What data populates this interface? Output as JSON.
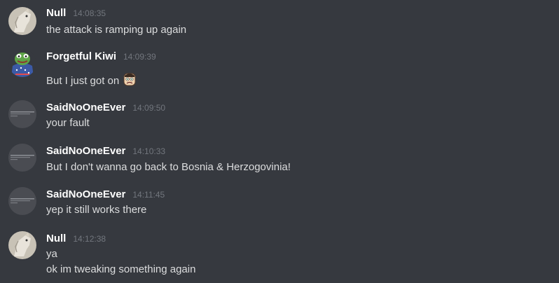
{
  "messages": [
    {
      "author": "Null",
      "timestamp": "14:08:35",
      "avatar": "horse-avatar",
      "lines": [
        "the attack is ramping up again"
      ]
    },
    {
      "author": "Forgetful Kiwi",
      "timestamp": "14:09:39",
      "avatar": "frog-flag-avatar",
      "lines": [
        "But I just got on"
      ],
      "emoji": "sad-face-emoji"
    },
    {
      "author": "SaidNoOneEver",
      "timestamp": "14:09:50",
      "avatar": "text-avatar",
      "lines": [
        "your fault"
      ]
    },
    {
      "author": "SaidNoOneEver",
      "timestamp": "14:10:33",
      "avatar": "text-avatar",
      "lines": [
        "But I don't wanna go back to Bosnia & Herzogovinia!"
      ]
    },
    {
      "author": "SaidNoOneEver",
      "timestamp": "14:11:45",
      "avatar": "text-avatar",
      "lines": [
        "yep it still works there"
      ]
    },
    {
      "author": "Null",
      "timestamp": "14:12:38",
      "avatar": "horse-avatar",
      "lines": [
        "ya",
        "ok im tweaking something again"
      ]
    }
  ],
  "colors": {
    "background": "#36393f",
    "author": "#ffffff",
    "timestamp": "#72767d",
    "text": "#dcddde"
  }
}
